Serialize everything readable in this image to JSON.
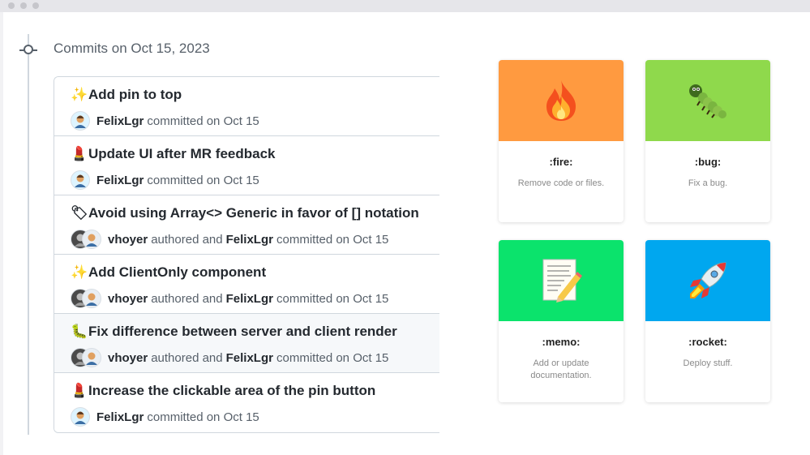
{
  "timeline": {
    "heading": "Commits on Oct 15, 2023"
  },
  "commits": [
    {
      "emoji": "✨",
      "title": "Add pin to top",
      "author": "FelixLgr",
      "action": "committed on Oct 15"
    },
    {
      "emoji": "💄",
      "title": "Update UI after MR feedback",
      "author": "FelixLgr",
      "action": "committed on Oct 15"
    },
    {
      "emoji": "🏷",
      "title": "Avoid using Array<> Generic in favor of [] notation",
      "author": "vhoyer",
      "authored_text": "authored and",
      "committer": "FelixLgr",
      "action": "committed on Oct 15"
    },
    {
      "emoji": "✨",
      "title": "Add ClientOnly component",
      "author": "vhoyer",
      "authored_text": "authored and",
      "committer": "FelixLgr",
      "action": "committed on Oct 15"
    },
    {
      "emoji": "🐛",
      "title": "Fix difference between server and client render",
      "author": "vhoyer",
      "authored_text": "authored and",
      "committer": "FelixLgr",
      "action": "committed on Oct 15"
    },
    {
      "emoji": "💄",
      "title": "Increase the clickable area of the pin button",
      "author": "FelixLgr",
      "action": "committed on Oct 15"
    }
  ],
  "gitmojis": [
    {
      "emoji": "🔥",
      "code": ":fire:",
      "description": "Remove code or files.",
      "color": "#ff9a40",
      "icon": "fire-icon"
    },
    {
      "emoji": "🐛",
      "code": ":bug:",
      "description": "Fix a bug.",
      "color": "#8fd94c",
      "icon": "bug-icon"
    },
    {
      "emoji": "📝",
      "code": ":memo:",
      "description": "Add or update documentation.",
      "color": "#0be36c",
      "icon": "memo-icon"
    },
    {
      "emoji": "🚀",
      "code": ":rocket:",
      "description": "Deploy stuff.",
      "color": "#00a7ef",
      "icon": "rocket-icon"
    }
  ]
}
